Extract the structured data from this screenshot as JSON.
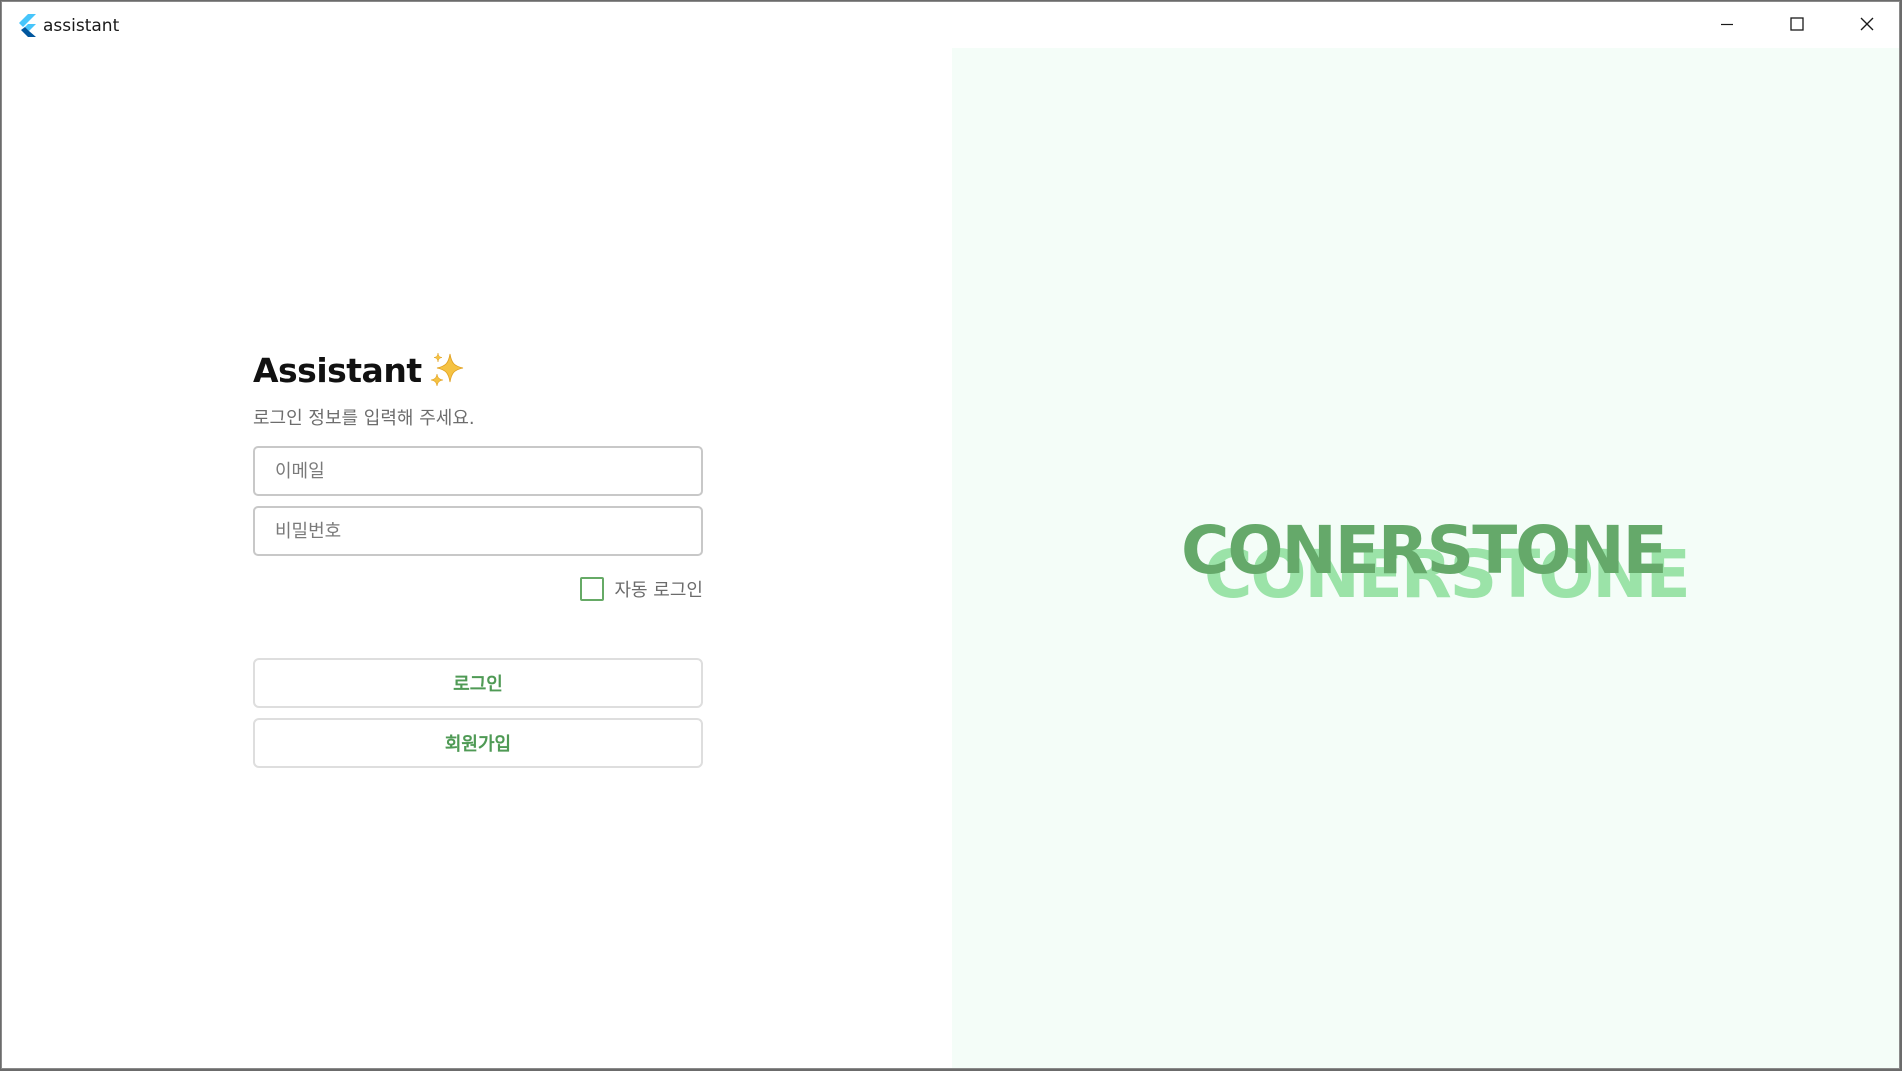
{
  "window": {
    "title": "assistant",
    "app_icon": "flutter-logo-icon",
    "controls": [
      "minimize-icon",
      "maximize-icon",
      "close-icon"
    ]
  },
  "login": {
    "title": "Assistant",
    "title_icon": "sparkles-icon",
    "subtitle": "로그인 정보를 입력해 주세요.",
    "email_placeholder": "이메일",
    "password_placeholder": "비밀번호",
    "auto_login_label": "자동 로그인",
    "auto_login_checked": false,
    "login_button": "로그인",
    "signup_button": "회원가입"
  },
  "brand": {
    "text": "CONERSTONE",
    "shadow_text": "CONERSTONE"
  },
  "colors": {
    "accent_green": "#65a96a",
    "shadow_green": "#9be3a8",
    "brand_panel_bg": "#f4fdf8",
    "button_text": "#4f9a55",
    "sparkle": "#f5c242"
  }
}
